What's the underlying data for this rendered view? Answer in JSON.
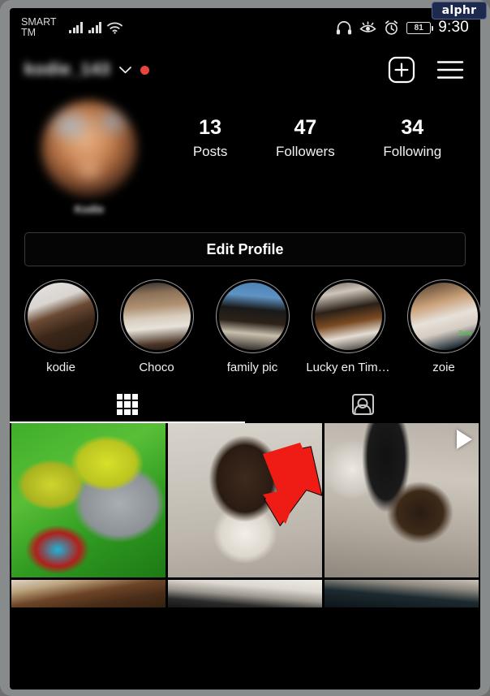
{
  "watermark": {
    "label": "alphr"
  },
  "status_bar": {
    "carrier": "SMART TM",
    "time": "9:30",
    "battery_percent": "81",
    "icons": [
      "signal-bars-icon",
      "signal-bars-icon",
      "wifi-icon",
      "headphones-icon",
      "eye-care-icon",
      "alarm-clock-icon",
      "battery-icon"
    ]
  },
  "top_bar": {
    "username": "kodie_143",
    "username_blurred": true,
    "chevron": "chevron-down-icon",
    "unread_badge": true,
    "add_label": "add-post-icon",
    "menu_label": "hamburger-menu-icon"
  },
  "profile": {
    "avatar_name": "profile-avatar",
    "display_name": "Kodie",
    "display_name_blurred": true,
    "stats": [
      {
        "value": "13",
        "label": "Posts"
      },
      {
        "value": "47",
        "label": "Followers"
      },
      {
        "value": "34",
        "label": "Following"
      }
    ],
    "edit_profile_label": "Edit Profile"
  },
  "highlights": [
    {
      "label": "kodie",
      "thumb_class": "p1",
      "overlay": ""
    },
    {
      "label": "Choco",
      "thumb_class": "p2",
      "overlay": ""
    },
    {
      "label": "family pic",
      "thumb_class": "p3",
      "overlay": ""
    },
    {
      "label": "Lucky en Tim…",
      "thumb_class": "p4",
      "overlay": ""
    },
    {
      "label": "zoie",
      "thumb_class": "p5",
      "overlay": "Zoie"
    }
  ],
  "tabs": [
    {
      "icon": "grid-icon",
      "active": true
    },
    {
      "icon": "tagged-photos-icon",
      "active": false
    }
  ],
  "photo_grid": [
    {
      "name": "post-crocs-lite-shoes",
      "class": "g1",
      "is_video": false
    },
    {
      "name": "post-puppy-portrait",
      "class": "g2",
      "is_video": false
    },
    {
      "name": "post-dog-floor-video",
      "class": "g3",
      "is_video": true
    },
    {
      "name": "post-wood-floor",
      "class": "g4",
      "is_video": false
    },
    {
      "name": "post-cables-desk",
      "class": "g5",
      "is_video": false
    },
    {
      "name": "post-dark-surface",
      "class": "g6",
      "is_video": false
    }
  ],
  "annotation": {
    "type": "red-arrow",
    "color": "#ee1c15",
    "points_to": "grid-tab-area"
  },
  "colors": {
    "background": "#000000",
    "accent_red": "#e8453c",
    "text_primary": "#ffffff",
    "frame": "#888b8c"
  }
}
